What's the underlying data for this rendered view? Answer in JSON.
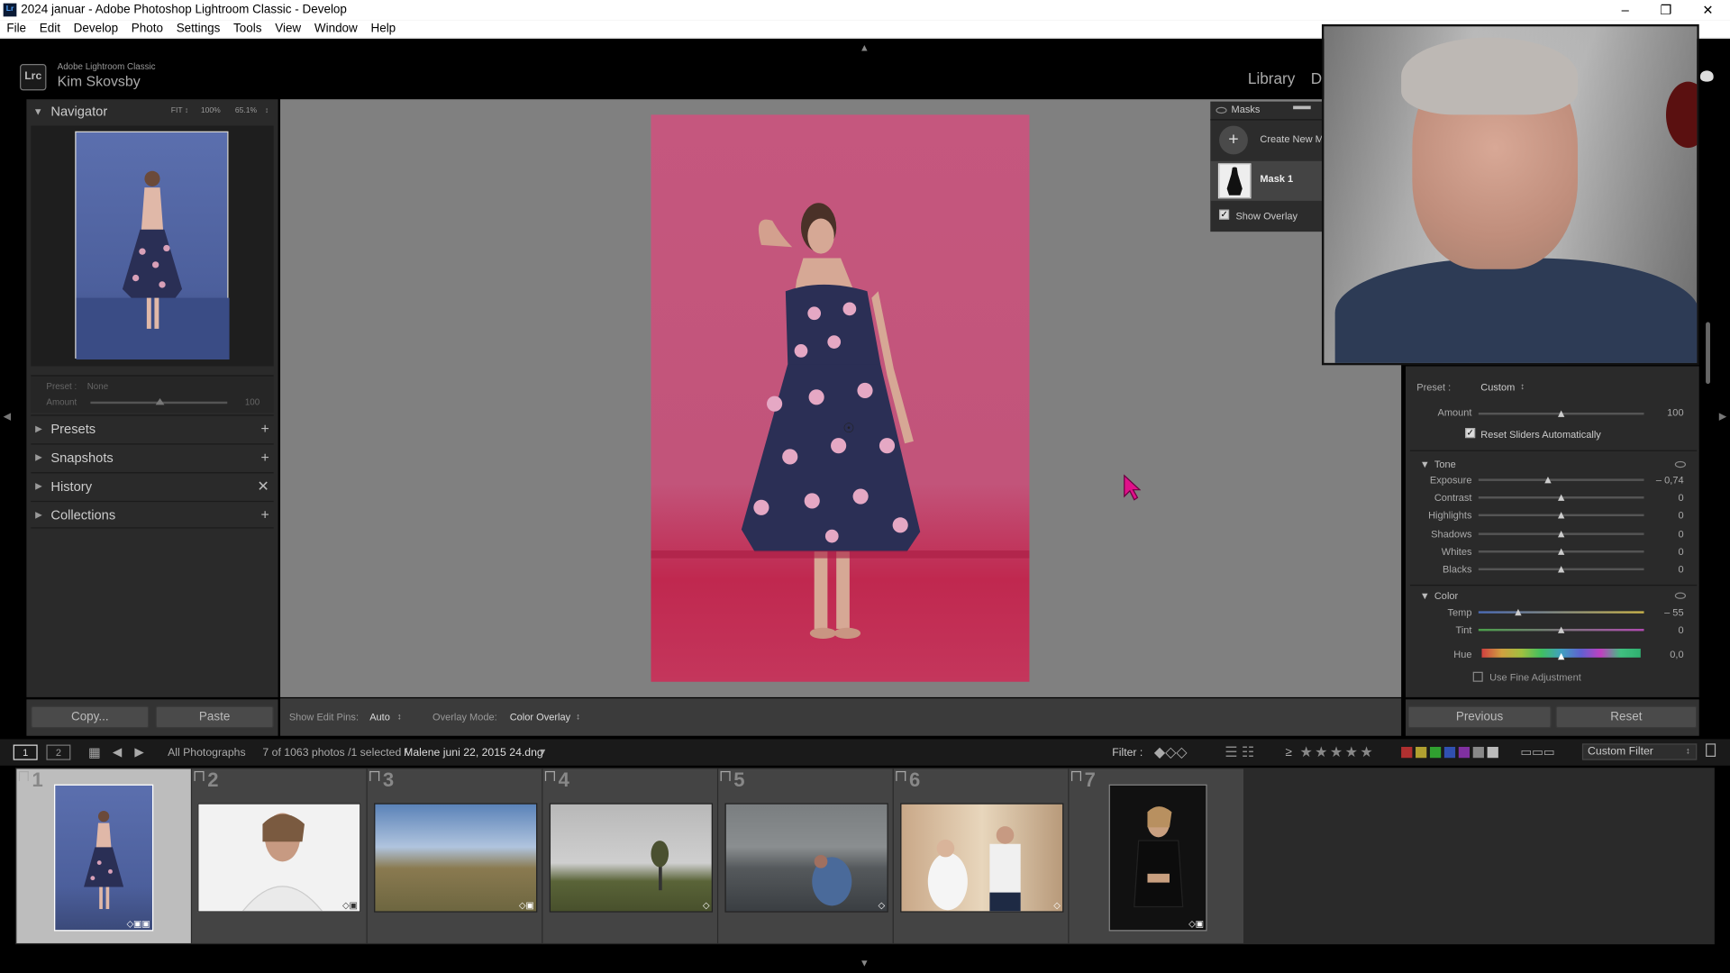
{
  "window": {
    "title": "2024 januar - Adobe Photoshop Lightroom Classic - Develop",
    "minimize": "–",
    "restore": "❐",
    "close": "✕"
  },
  "menu": [
    "File",
    "Edit",
    "Develop",
    "Photo",
    "Settings",
    "Tools",
    "View",
    "Window",
    "Help"
  ],
  "identity": {
    "app": "Adobe Lightroom Classic",
    "user": "Kim Skovsby",
    "logo": "Lrc"
  },
  "modules": {
    "library": "Library",
    "next": "D"
  },
  "navigator": {
    "title": "Navigator",
    "fit": "FIT ↕",
    "zoom1": "100%",
    "zoom2": "65.1%"
  },
  "preset_box": {
    "preset_label": "Preset :",
    "preset_value": "None",
    "amount_label": "Amount",
    "amount_value": "100"
  },
  "left_sections": [
    {
      "label": "Presets",
      "action": "+"
    },
    {
      "label": "Snapshots",
      "action": "+"
    },
    {
      "label": "History",
      "action": "✕"
    },
    {
      "label": "Collections",
      "action": "+"
    }
  ],
  "left_buttons": {
    "copy": "Copy...",
    "paste": "Paste"
  },
  "masks": {
    "title": "Masks",
    "create": "Create New M",
    "mask1": "Mask 1",
    "show_overlay": "Show Overlay",
    "show_overlay_checked": true
  },
  "toolbar": {
    "edit_pins_label": "Show Edit Pins:",
    "edit_pins_value": "Auto",
    "overlay_label": "Overlay Mode:",
    "overlay_value": "Color Overlay"
  },
  "right": {
    "preset_label": "Preset :",
    "preset_value": "Custom",
    "amount_label": "Amount",
    "amount_value": "100",
    "reset_sliders": "Reset Sliders Automatically",
    "tone_title": "Tone",
    "tone": [
      {
        "label": "Exposure",
        "value": "– 0,74"
      },
      {
        "label": "Contrast",
        "value": "0"
      },
      {
        "label": "Highlights",
        "value": "0"
      },
      {
        "label": "Shadows",
        "value": "0"
      },
      {
        "label": "Whites",
        "value": "0"
      },
      {
        "label": "Blacks",
        "value": "0"
      }
    ],
    "color_title": "Color",
    "color": [
      {
        "label": "Temp",
        "value": "– 55"
      },
      {
        "label": "Tint",
        "value": "0"
      },
      {
        "label": "Hue",
        "value": "0,0"
      }
    ],
    "fine_adjust": "Use Fine Adjustment",
    "previous": "Previous",
    "reset": "Reset"
  },
  "filmbar": {
    "view1": "1",
    "view2": "2",
    "source": "All Photographs",
    "count": "7 of 1063 photos /1 selected /",
    "filename": "Malene juni 22, 2015 24.dng",
    "filter_label": "Filter :",
    "rating_op": "≥",
    "stars": "★★★★★",
    "custom_filter": "Custom Filter"
  },
  "filmstrip": [
    {
      "num": "1",
      "selected": true
    },
    {
      "num": "2",
      "selected": false
    },
    {
      "num": "3",
      "selected": false
    },
    {
      "num": "4",
      "selected": false
    },
    {
      "num": "5",
      "selected": false
    },
    {
      "num": "6",
      "selected": false
    },
    {
      "num": "7",
      "selected": false
    }
  ],
  "colors": {
    "mask_overlay": "#c5577e",
    "panel": "#2a2a2a",
    "background": "#808080",
    "cursor": "#e0108a"
  }
}
